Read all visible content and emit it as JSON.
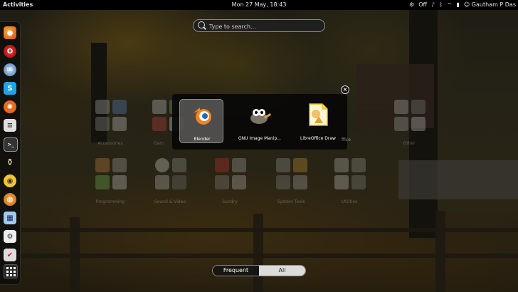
{
  "topbar": {
    "activities": "Activities",
    "clock": "Mon 27 May, 18:43",
    "status": {
      "wifi_label": "Off",
      "user": "Gautham P Das"
    }
  },
  "search": {
    "placeholder": "Type to search..."
  },
  "dash": {
    "items": [
      "firefox-icon",
      "opera-icon",
      "thunderbird-icon",
      "skype-icon",
      "ubuntu-icon",
      "document-icon",
      "terminal-icon",
      "vlc-icon",
      "gnome-icon",
      "nautilus-icon",
      "image-viewer-icon",
      "settings-icon",
      "tasks-icon",
      "apps-grid-icon"
    ]
  },
  "folders": [
    {
      "label": "Accessories"
    },
    {
      "label": "Gam"
    },
    {
      "label": "Other"
    },
    {
      "label": "Programming"
    },
    {
      "label": "Sound & Video"
    },
    {
      "label": "Sundry"
    },
    {
      "label": "System Tools"
    },
    {
      "label": "Utilities"
    }
  ],
  "collection": {
    "apps": [
      {
        "label": "Blender",
        "selected": true
      },
      {
        "label": "GNU Image Manip...",
        "selected": false
      },
      {
        "label": "LibreOffice Draw",
        "selected": false
      }
    ],
    "partial_label": "ffice"
  },
  "view_switcher": {
    "frequent": "Frequent",
    "all": "All",
    "active": "All"
  }
}
